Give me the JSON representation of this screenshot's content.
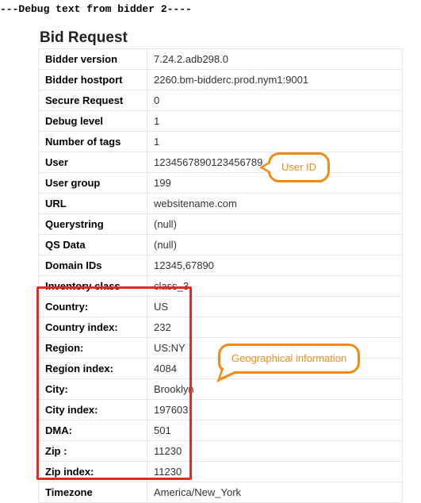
{
  "header": {
    "debug_line": "---Debug text from bidder 2----"
  },
  "request": {
    "title": "Bid Request",
    "rows": [
      {
        "label": "Bidder version",
        "value": "7.24.2.adb298.0"
      },
      {
        "label": "Bidder hostport",
        "value": "2260.bm-bidderc.prod.nym1:9001"
      },
      {
        "label": "Secure Request",
        "value": "0"
      },
      {
        "label": "Debug level",
        "value": "1"
      },
      {
        "label": "Number of tags",
        "value": "1"
      },
      {
        "label": "User",
        "value": "1234567890123456789"
      },
      {
        "label": "User group",
        "value": "199"
      },
      {
        "label": "URL",
        "value": "websitename.com"
      },
      {
        "label": "Querystring",
        "value": "(null)"
      },
      {
        "label": "QS Data",
        "value": "(null)"
      },
      {
        "label": "Domain IDs",
        "value": "12345,67890"
      },
      {
        "label": "Inventory class",
        "value": "class_3"
      },
      {
        "label": "Country:",
        "value": "US"
      },
      {
        "label": "Country index:",
        "value": "232"
      },
      {
        "label": "Region:",
        "value": "US:NY"
      },
      {
        "label": "Region index:",
        "value": "4084"
      },
      {
        "label": "City:",
        "value": "Brooklyn"
      },
      {
        "label": "City index:",
        "value": "197603"
      },
      {
        "label": "DMA:",
        "value": "501"
      },
      {
        "label": "Zip :",
        "value": "11230"
      },
      {
        "label": "Zip index:",
        "value": "11230"
      },
      {
        "label": "Timezone",
        "value": "America/New_York"
      }
    ]
  },
  "annotations": {
    "user_id_callout": "User ID",
    "geo_callout": "Geographical information"
  },
  "highlight": {
    "geo_rows_start": 12,
    "geo_rows_end": 20
  },
  "colors": {
    "callout_border": "#f28a17",
    "highlight_border": "#e8281f",
    "table_border": "#e6e6e6"
  }
}
